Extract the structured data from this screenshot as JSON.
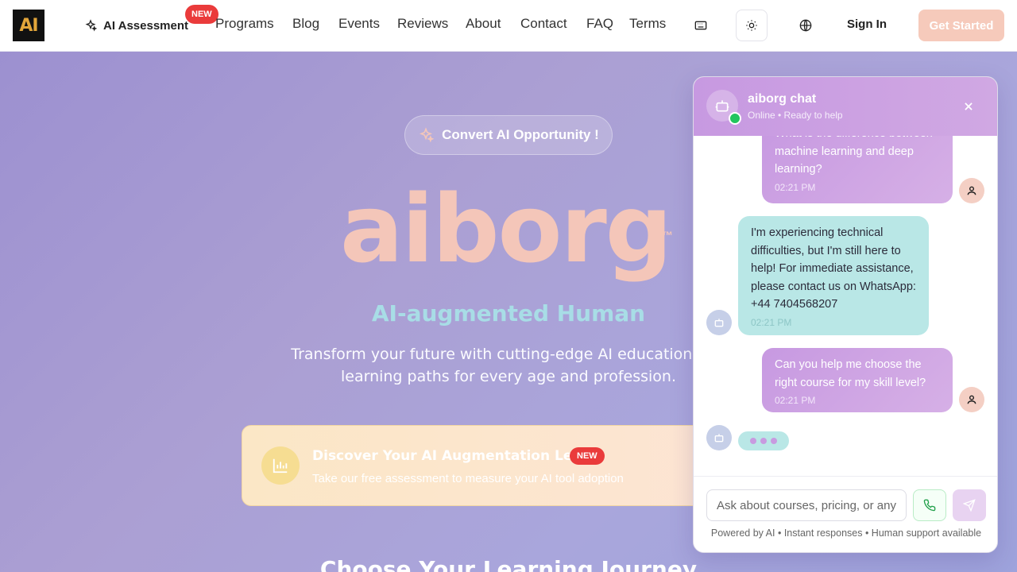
{
  "nav": {
    "logo_text": "AI",
    "ai_assessment_label": "AI Assessment",
    "new_badge": "NEW",
    "links": [
      "Programs",
      "Blog",
      "Events",
      "Reviews",
      "About",
      "Contact",
      "FAQ",
      "Terms"
    ],
    "icons": [
      "keyboard-icon",
      "sun-icon",
      "globe-icon"
    ],
    "sign_in": "Sign In",
    "get_started": "Get Started"
  },
  "hero": {
    "pill_label": "Convert AI Opportunity !",
    "brand": "aiborg",
    "trademark": "™",
    "subtitle": "AI-augmented Human",
    "description_line1": "Transform your future with cutting-edge AI education. Per",
    "description_line2": "learning paths for every age and profession.",
    "assessment": {
      "title": "Discover Your AI Augmentation Level",
      "badge": "NEW",
      "subtitle": "Take our free assessment to measure your AI tool adoption"
    },
    "section_heading": "Choose Your Learning Journey"
  },
  "chat": {
    "title": "aiborg chat",
    "status": "Online • Ready to help",
    "messages": [
      {
        "sender": "user",
        "text": "What is the difference between machine learning and deep learning?",
        "time": "02:21 PM"
      },
      {
        "sender": "bot",
        "text": "I'm experiencing technical difficulties, but I'm still here to help! For immediate assistance, please contact us on WhatsApp: +44 7404568207",
        "time": "02:21 PM"
      },
      {
        "sender": "user",
        "text": "Can you help me choose the right course for my skill level?",
        "time": "02:21 PM"
      }
    ],
    "input_placeholder": "Ask about courses, pricing, or anything",
    "footer": "Powered by AI • Instant responses • Human support available"
  },
  "colors": {
    "brand_peach": "#f4c6b9",
    "accent_purple": "#c799e1",
    "bot_bubble": "#b9e7e6",
    "new_red": "#ea3b3b"
  }
}
